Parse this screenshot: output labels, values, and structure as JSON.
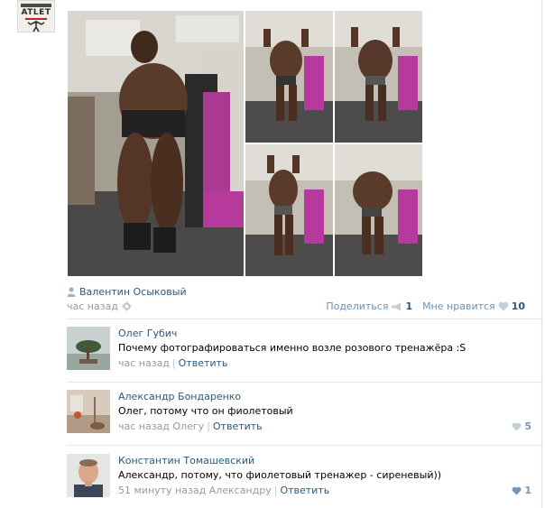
{
  "group": {
    "logo_text": "ATLET"
  },
  "post": {
    "author": "Валентин Осыковый",
    "time": "час назад",
    "share_label": "Поделиться",
    "share_count": "1",
    "like_label": "Мне нравится",
    "like_count": "10"
  },
  "comments": [
    {
      "name": "Олег Губич",
      "text": "Почему фотографироваться именно возле розового тренажёра :S",
      "time": "час назад",
      "to": "",
      "reply_label": "Ответить",
      "likes": ""
    },
    {
      "name": "Александр Бондаренко",
      "text": "Олег, потому что он фиолетовый",
      "time": "час назад",
      "to": "Олегу",
      "reply_label": "Ответить",
      "likes": "5"
    },
    {
      "name": "Константин Томашевский",
      "text": "Александр, потому, что фиолетовый тренажер - сиреневый))",
      "time": "51 минуту назад",
      "to": "Александру",
      "reply_label": "Ответить",
      "likes": "1"
    }
  ],
  "colors": {
    "link": "#2b587a",
    "muted": "#999999",
    "accent": "#6d8fb3",
    "machine": "#b53a9c"
  },
  "icons": [
    "user-icon",
    "gear-icon",
    "megaphone-icon",
    "heart-icon"
  ]
}
